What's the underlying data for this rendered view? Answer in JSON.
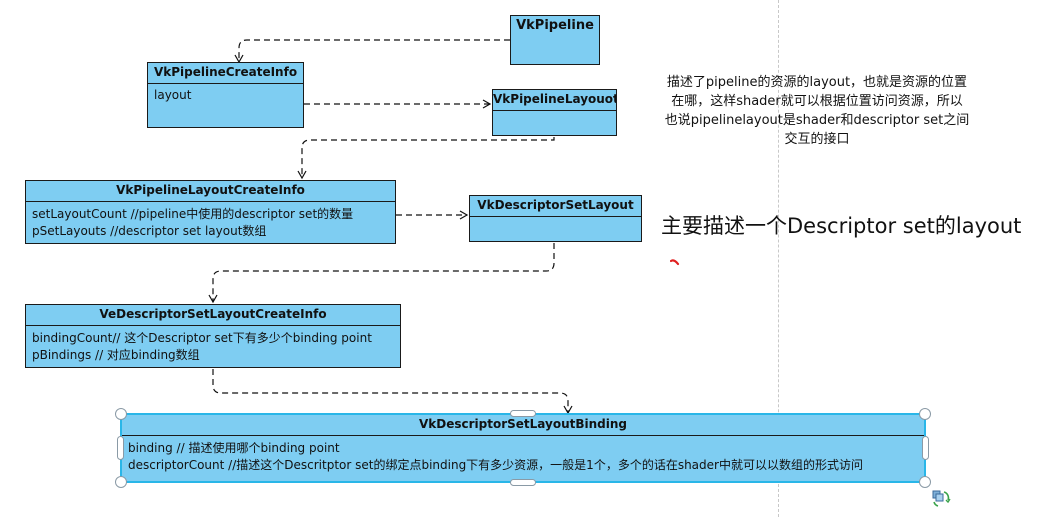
{
  "nodes": {
    "vkpipeline": {
      "title": "VkPipeline",
      "lines": []
    },
    "pipeline_create_info": {
      "title": "VkPipelineCreateInfo",
      "lines": [
        "layout"
      ]
    },
    "pipeline_layout": {
      "title": "VkPipelineLayouot",
      "lines": []
    },
    "pipeline_layout_create_info": {
      "title": "VkPipelineLayoutCreateInfo",
      "lines": [
        "setLayoutCount //pipeline中使用的descriptor set的数量",
        "pSetLayouts //descriptor set layout数组"
      ]
    },
    "descriptor_set_layout": {
      "title": "VkDescriptorSetLayout",
      "lines": []
    },
    "descriptor_set_layout_create_info": {
      "title": "VeDescriptorSetLayoutCreateInfo",
      "lines": [
        "bindingCount// 这个Descriptor set下有多少个binding point",
        "pBindings // 对应binding数组"
      ]
    },
    "descriptor_set_layout_binding": {
      "title": "VkDescriptorSetLayoutBinding",
      "lines": [
        "binding // 描述使用哪个binding point",
        "descriptorCount //描述这个Descritptor set的绑定点binding下有多少资源，一般是1个，多个的话在shader中就可以以数组的形式访问"
      ]
    }
  },
  "notes": {
    "pipeline_layout_note": [
      "描述了pipeline的资源的layout，也就是资源的位置",
      "在哪，这样shader就可以根据位置访问资源，所以",
      "也说pipelinelayout是shader和descriptor set之间",
      "交互的接口"
    ],
    "descriptor_set_note": "主要描述一个Descriptor set的layout"
  },
  "colors": {
    "node_fill": "#7ecdf2",
    "node_border": "#1a1a1a",
    "selection": "#29b6e8",
    "accent_dot": "#e02020"
  }
}
